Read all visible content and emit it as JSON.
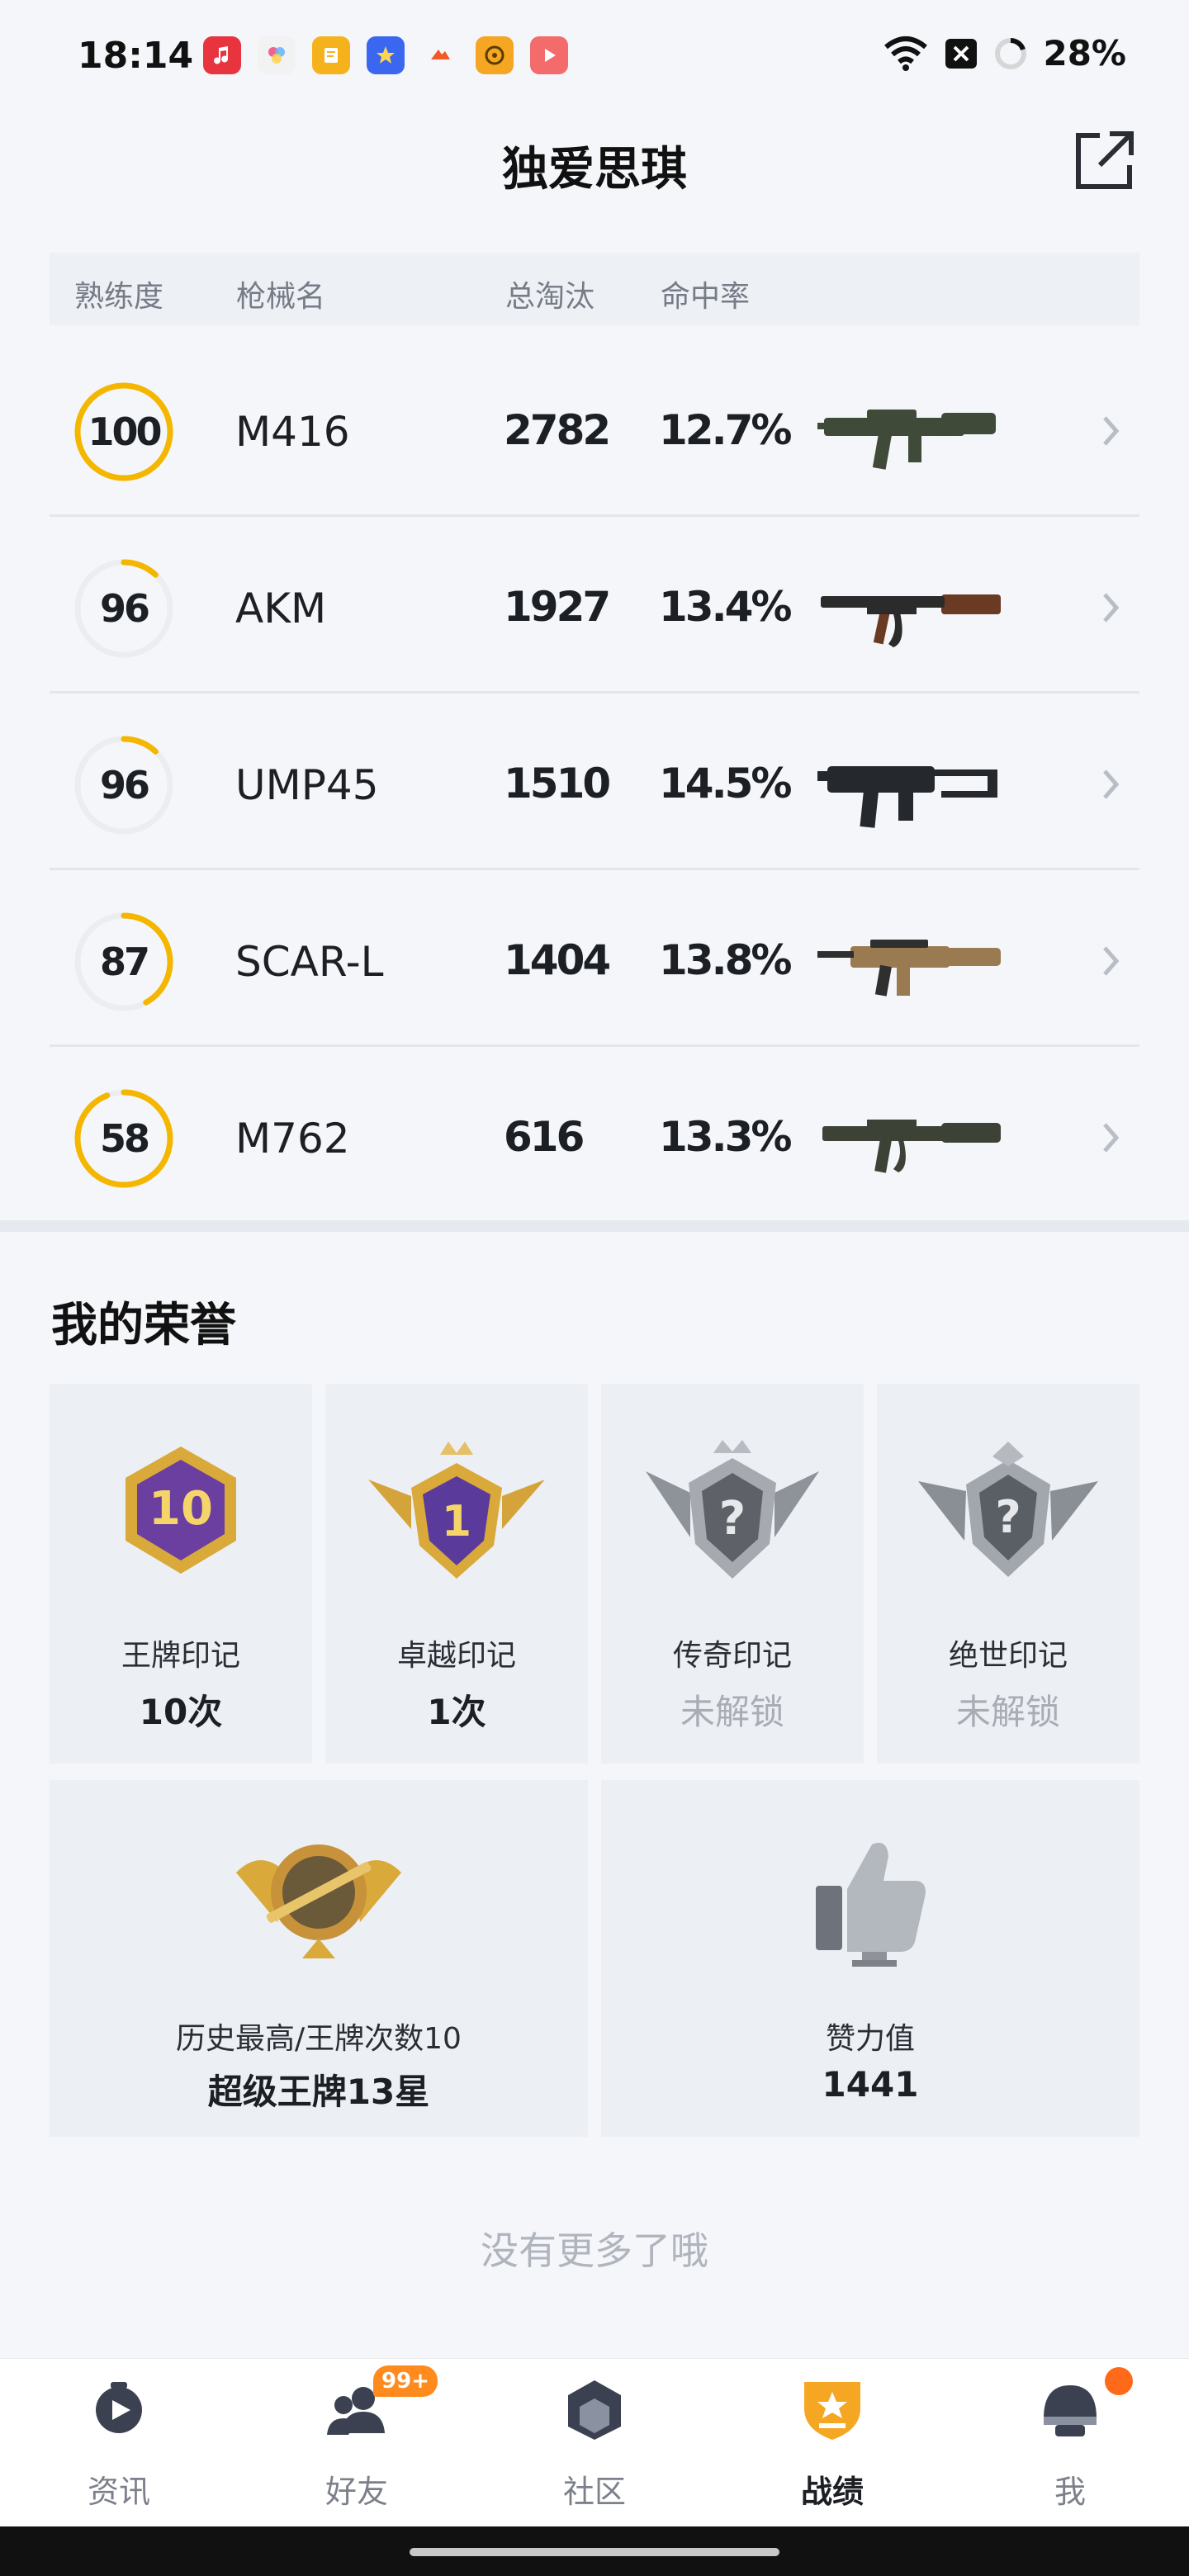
{
  "status_bar": {
    "time": "18:14",
    "battery": "28%"
  },
  "header": {
    "title": "独爱思琪"
  },
  "weapons": {
    "columns": [
      "熟练度",
      "枪械名",
      "总淘汰",
      "命中率"
    ],
    "rows": [
      {
        "mastery": "100",
        "progress": 1.0,
        "name": "M416",
        "eliminations": "2782",
        "hit_rate": "12.7%",
        "gun_color": "#3f4a38"
      },
      {
        "mastery": "96",
        "progress": 0.12,
        "name": "AKM",
        "eliminations": "1927",
        "hit_rate": "13.4%",
        "gun_color": "#6b3a22"
      },
      {
        "mastery": "96",
        "progress": 0.12,
        "name": "UMP45",
        "eliminations": "1510",
        "hit_rate": "14.5%",
        "gun_color": "#25282c"
      },
      {
        "mastery": "87",
        "progress": 0.42,
        "name": "SCAR-L",
        "eliminations": "1404",
        "hit_rate": "13.8%",
        "gun_color": "#9a7a50"
      },
      {
        "mastery": "58",
        "progress": 0.94,
        "name": "M762",
        "eliminations": "616",
        "hit_rate": "13.3%",
        "gun_color": "#3c4236"
      }
    ]
  },
  "honors": {
    "title": "我的荣誉",
    "badges": [
      {
        "label": "王牌印记",
        "value": "10次",
        "locked": false,
        "emblem_text": "10"
      },
      {
        "label": "卓越印记",
        "value": "1次",
        "locked": false,
        "emblem_text": "1"
      },
      {
        "label": "传奇印记",
        "value": "未解锁",
        "locked": true,
        "emblem_text": "?"
      },
      {
        "label": "绝世印记",
        "value": "未解锁",
        "locked": true,
        "emblem_text": "?"
      }
    ],
    "highest": {
      "label": "历史最高/王牌次数10",
      "value": "超级王牌13星"
    },
    "likes": {
      "label": "赞力值",
      "value": "1441"
    }
  },
  "footer_note": "没有更多了哦",
  "nav": {
    "items": [
      "资讯",
      "好友",
      "社区",
      "战绩",
      "我"
    ],
    "active_index": 3,
    "friends_badge": "99+"
  },
  "colors": {
    "accent": "#f5b600",
    "active_nav": "#f5a623"
  }
}
